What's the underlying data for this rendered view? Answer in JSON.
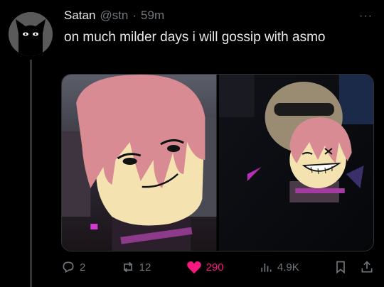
{
  "author": {
    "name": "Satan",
    "handle": "@stn",
    "separator": "·",
    "time": "59m"
  },
  "more_label": "···",
  "tweet": {
    "text": "on much milder days i will gossip with asmo"
  },
  "media": {
    "count": 2
  },
  "actions": {
    "replies": "2",
    "reposts": "12",
    "likes": "290",
    "views": "4.9K",
    "liked": true
  },
  "colors": {
    "like_active": "#f91880",
    "muted": "#71767b",
    "text": "#e7e9ea",
    "background": "#000000"
  },
  "icons": {
    "reply": "reply-icon",
    "repost": "repost-icon",
    "like": "heart-filled-icon",
    "views": "analytics-icon",
    "bookmark": "bookmark-icon",
    "share": "share-icon"
  }
}
